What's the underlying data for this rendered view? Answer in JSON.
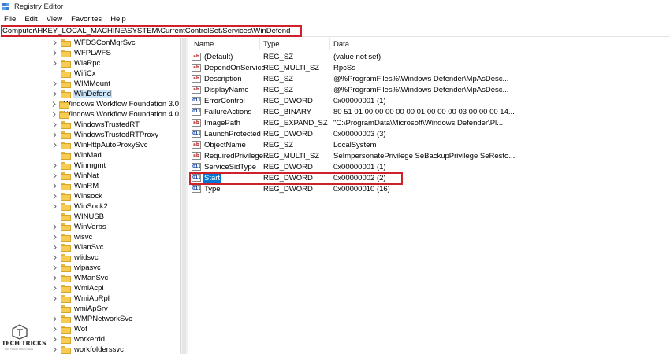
{
  "window": {
    "title": "Registry Editor",
    "icon": "registry-editor-icon"
  },
  "menu": [
    "File",
    "Edit",
    "View",
    "Favorites",
    "Help"
  ],
  "address": {
    "path": "Computer\\HKEY_LOCAL_MACHINE\\SYSTEM\\CurrentControlSet\\Services\\WinDefend"
  },
  "tree": {
    "selected": "WinDefend",
    "items": [
      {
        "label": "WFDSConMgrSvc",
        "expandable": true
      },
      {
        "label": "WFPLWFS",
        "expandable": true
      },
      {
        "label": "WiaRpc",
        "expandable": true
      },
      {
        "label": "WifiCx",
        "expandable": false
      },
      {
        "label": "WIMMount",
        "expandable": true
      },
      {
        "label": "WinDefend",
        "expandable": true
      },
      {
        "label": "Windows Workflow Foundation 3.0",
        "expandable": true
      },
      {
        "label": "Windows Workflow Foundation 4.0",
        "expandable": true
      },
      {
        "label": "WindowsTrustedRT",
        "expandable": true
      },
      {
        "label": "WindowsTrustedRTProxy",
        "expandable": true
      },
      {
        "label": "WinHttpAutoProxySvc",
        "expandable": true
      },
      {
        "label": "WinMad",
        "expandable": false
      },
      {
        "label": "Winmgmt",
        "expandable": true
      },
      {
        "label": "WinNat",
        "expandable": true
      },
      {
        "label": "WinRM",
        "expandable": true
      },
      {
        "label": "Winsock",
        "expandable": true
      },
      {
        "label": "WinSock2",
        "expandable": true
      },
      {
        "label": "WINUSB",
        "expandable": false
      },
      {
        "label": "WinVerbs",
        "expandable": true
      },
      {
        "label": "wisvc",
        "expandable": true
      },
      {
        "label": "WlanSvc",
        "expandable": true
      },
      {
        "label": "wlidsvc",
        "expandable": true
      },
      {
        "label": "wlpasvc",
        "expandable": true
      },
      {
        "label": "WManSvc",
        "expandable": true
      },
      {
        "label": "WmiAcpi",
        "expandable": true
      },
      {
        "label": "WmiApRpl",
        "expandable": true
      },
      {
        "label": "wmiApSrv",
        "expandable": false
      },
      {
        "label": "WMPNetworkSvc",
        "expandable": true
      },
      {
        "label": "Wof",
        "expandable": true
      },
      {
        "label": "workerdd",
        "expandable": true
      },
      {
        "label": "workfolderssvc",
        "expandable": true
      }
    ]
  },
  "columns": {
    "name": "Name",
    "type": "Type",
    "data": "Data"
  },
  "values": [
    {
      "name": "(Default)",
      "type": "REG_SZ",
      "data": "(value not set)",
      "icon": "ab"
    },
    {
      "name": "DependOnService",
      "type": "REG_MULTI_SZ",
      "data": "RpcSs",
      "icon": "ab"
    },
    {
      "name": "Description",
      "type": "REG_SZ",
      "data": "@%ProgramFiles%\\Windows Defender\\MpAsDesc...",
      "icon": "ab"
    },
    {
      "name": "DisplayName",
      "type": "REG_SZ",
      "data": "@%ProgramFiles%\\Windows Defender\\MpAsDesc...",
      "icon": "ab"
    },
    {
      "name": "ErrorControl",
      "type": "REG_DWORD",
      "data": "0x00000001 (1)",
      "icon": "bin"
    },
    {
      "name": "FailureActions",
      "type": "REG_BINARY",
      "data": "80 51 01 00 00 00 00 00 01 00 00 00 03 00 00 00 14...",
      "icon": "bin"
    },
    {
      "name": "ImagePath",
      "type": "REG_EXPAND_SZ",
      "data": "\"C:\\ProgramData\\Microsoft\\Windows Defender\\Pl...",
      "icon": "ab"
    },
    {
      "name": "LaunchProtected",
      "type": "REG_DWORD",
      "data": "0x00000003 (3)",
      "icon": "bin"
    },
    {
      "name": "ObjectName",
      "type": "REG_SZ",
      "data": "LocalSystem",
      "icon": "ab"
    },
    {
      "name": "RequiredPrivilege...",
      "type": "REG_MULTI_SZ",
      "data": "SeImpersonatePrivilege SeBackupPrivilege SeResto...",
      "icon": "ab"
    },
    {
      "name": "ServiceSidType",
      "type": "REG_DWORD",
      "data": "0x00000001 (1)",
      "icon": "bin"
    },
    {
      "name": "Start",
      "type": "REG_DWORD",
      "data": "0x00000002 (2)",
      "icon": "bin"
    },
    {
      "name": "Type",
      "type": "REG_DWORD",
      "data": "0x00000010 (16)",
      "icon": "bin"
    }
  ],
  "selected_value": "Start",
  "watermark": {
    "text": "TECH TRICKS",
    "sub": "THỦ THUẬT CÔNG NGHỆ",
    "icon": "techtricks-logo-icon"
  },
  "colors": {
    "selection": "#0078d7",
    "tree_selection": "#cce4f7",
    "highlight_box": "#d0202a",
    "folder": "#f6cc53"
  }
}
